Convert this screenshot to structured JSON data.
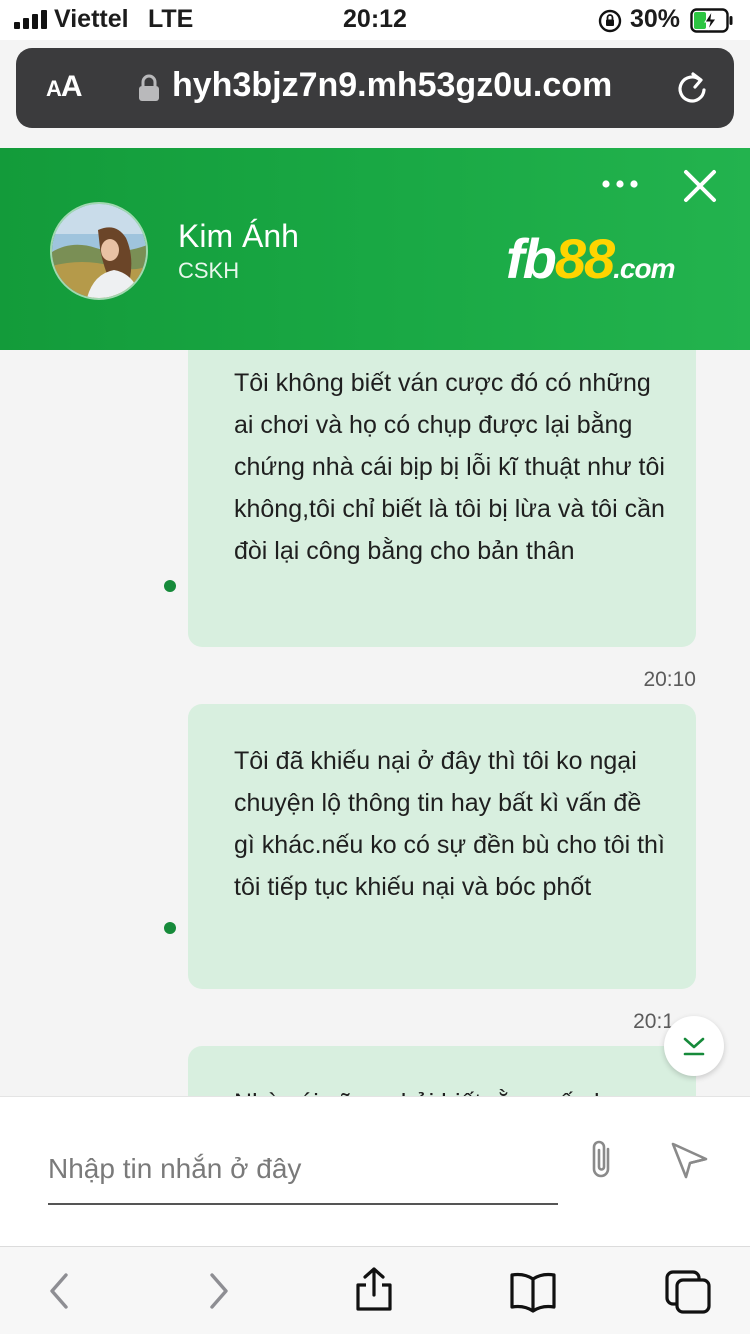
{
  "status_bar": {
    "carrier": "Viettel",
    "network": "LTE",
    "time": "20:12",
    "battery_percent": "30%"
  },
  "browser": {
    "text_size_label": "AA",
    "url": "hyh3bjz7n9.mh53gz0u.com"
  },
  "chat_header": {
    "agent_name": "Kim Ánh",
    "agent_role": "CSKH",
    "brand": {
      "part1": "fb",
      "part2": "88",
      "part3": ".com"
    },
    "colors": {
      "header_green": "#19a844",
      "brand_yellow": "#ffd400"
    }
  },
  "messages": [
    {
      "text": "Tôi không biết ván cược đó có những ai chơi và họ có chụp được lại bằng chứng nhà cái bịp bị lỗi kĩ thuật như tôi không,tôi chỉ biết là tôi bị lừa và tôi cần đòi lại công bằng cho bản thân",
      "time": "20:10"
    },
    {
      "text": "Tôi đã khiếu nại ở đây thì tôi ko ngại chuyện lộ thông tin hay bất kì vấn đề gì khác.nếu ko có sự đền bù cho tôi thì tôi tiếp tục khiếu nại và bóc phốt",
      "time": "20:1"
    },
    {
      "text": "Nhà cái cũng phải biết rằng nếu ko"
    }
  ],
  "composer": {
    "placeholder": "Nhập tin nhắn ở đây"
  },
  "icons": {
    "more": "more-icon",
    "close": "close-icon",
    "attach": "paperclip-icon",
    "send": "send-icon",
    "scroll_down": "chevron-down-icon"
  }
}
